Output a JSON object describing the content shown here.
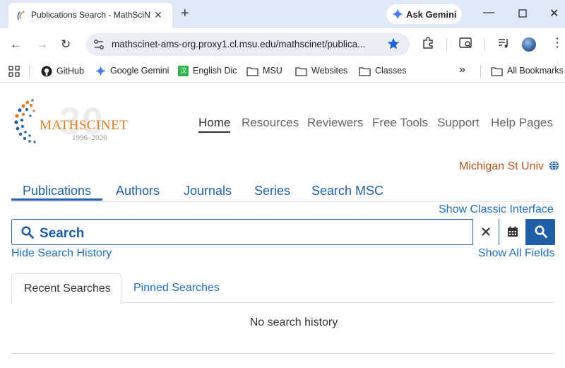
{
  "browser": {
    "tab_title": "Publications Search - MathSciN",
    "new_tab_symbol": "+",
    "ask_gemini": "Ask Gemini",
    "url": "mathscinet-ams-org.proxy1.cl.msu.edu/mathscinet/publica...",
    "bookmarks": [
      "GitHub",
      "Google Gemini",
      "English Dic",
      "MSU",
      "Websites",
      "Classes"
    ],
    "overflow": "»",
    "all_bookmarks": "All Bookmarks"
  },
  "logo": {
    "name": "MATHSCINET",
    "years": "1996–2026"
  },
  "site_nav": [
    "Home",
    "Resources",
    "Reviewers",
    "Free Tools",
    "Support",
    "Help Pages"
  ],
  "institution": "Michigan St Univ",
  "search_tabs": [
    "Publications",
    "Authors",
    "Journals",
    "Series",
    "Search MSC"
  ],
  "classic_link": "Show Classic Interface",
  "search": {
    "placeholder": "Search"
  },
  "hide_history": "Hide Search History",
  "show_fields": "Show All Fields",
  "history_tabs": [
    "Recent Searches",
    "Pinned Searches"
  ],
  "no_history": "No search history",
  "colors": {
    "accent": "#1e5fa8",
    "institution": "#b5531b",
    "tabstrip": "#dfe8f7"
  }
}
